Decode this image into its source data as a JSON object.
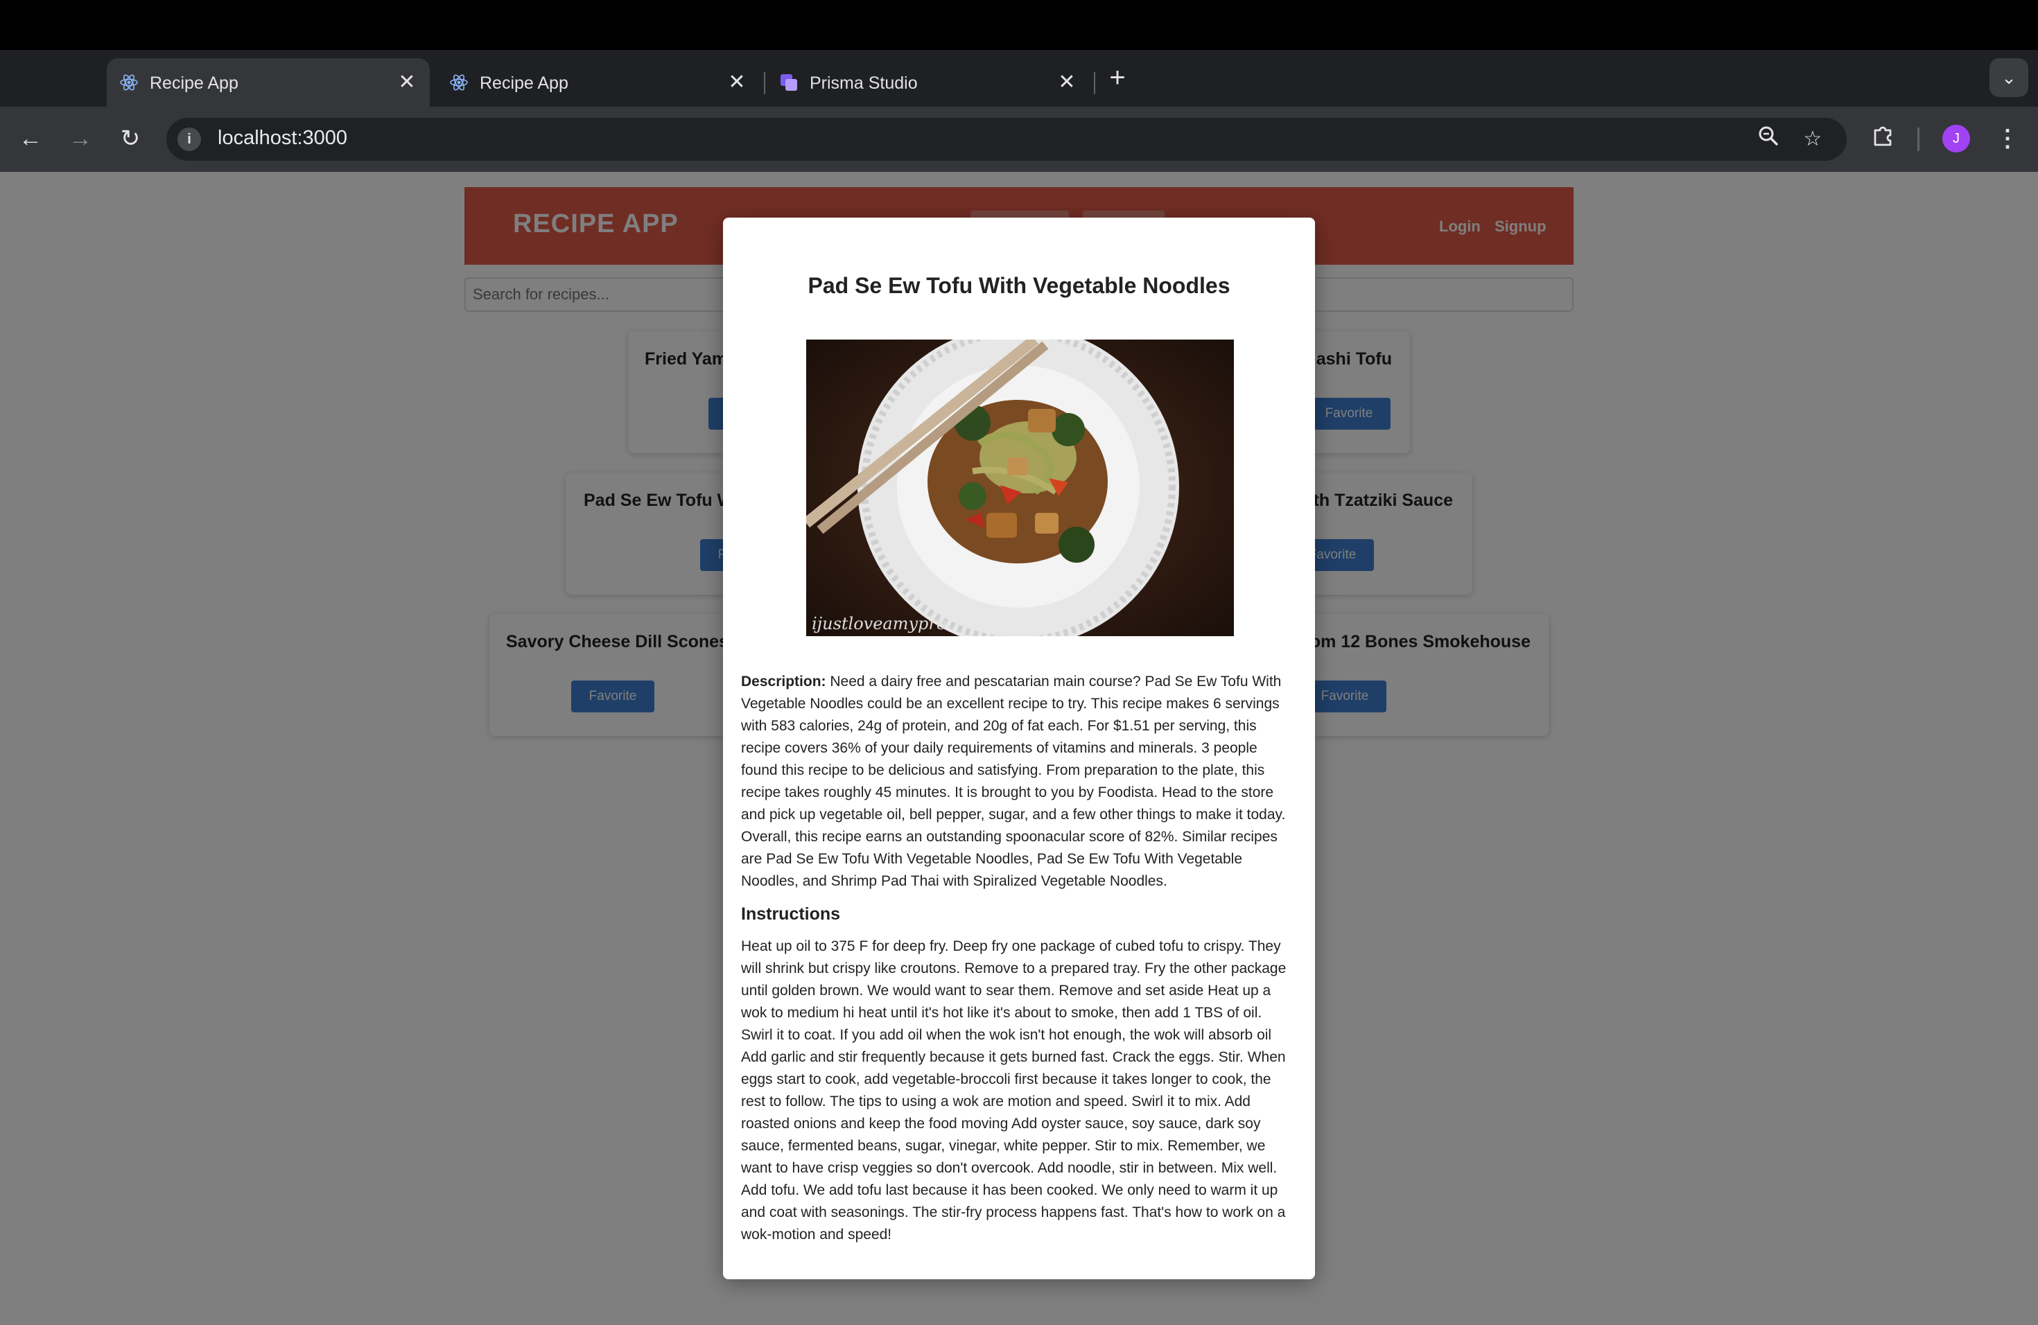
{
  "browser": {
    "tabs": [
      {
        "title": "Recipe App",
        "icon": "react-icon",
        "active": true
      },
      {
        "title": "Recipe App",
        "icon": "react-icon",
        "active": false
      },
      {
        "title": "Prisma Studio",
        "icon": "prisma-icon",
        "active": false
      }
    ],
    "url": "localhost:3000",
    "profile_initial": "J",
    "colors": {
      "profile": "#a142f4",
      "tabstrip": "#1f2023",
      "toolbar": "#35363a"
    }
  },
  "app": {
    "brand": "RECIPE APP",
    "auth": {
      "login": "Login",
      "signup": "Signup"
    },
    "search": {
      "placeholder": "Search for recipes..."
    },
    "colors": {
      "header": "#e05a48",
      "button": "#3f7fd1"
    },
    "cards": [
      {
        "title": "Fried Yam",
        "favorite": "Favorite"
      },
      {
        "title": "ashi Tofu",
        "favorite": "Favorite"
      },
      {
        "title": "Pad Se Ew Tofu W",
        "favorite": "Favorite"
      },
      {
        "title": "ith Tzatziki Sauce",
        "favorite": "Favorite"
      },
      {
        "title": "Savory Cheese Dill Scones",
        "favorite": "Favorite"
      },
      {
        "title": "rom 12 Bones Smokehouse",
        "favorite": "Favorite"
      }
    ]
  },
  "modal": {
    "title": "Pad Se Ew Tofu With Vegetable Noodles",
    "image_watermark": "ijustloveamypro",
    "description_label": "Description:",
    "description": "Need a dairy free and pescatarian main course? Pad Se Ew Tofu With Vegetable Noodles could be an excellent recipe to try. This recipe makes 6 servings with 583 calories, 24g of protein, and 20g of fat each. For $1.51 per serving, this recipe covers 36% of your daily requirements of vitamins and minerals. 3 people found this recipe to be delicious and satisfying. From preparation to the plate, this recipe takes roughly 45 minutes. It is brought to you by Foodista. Head to the store and pick up vegetable oil, bell pepper, sugar, and a few other things to make it today. Overall, this recipe earns an outstanding spoonacular score of 82%. Similar recipes are Pad Se Ew Tofu With Vegetable Noodles, Pad Se Ew Tofu With Vegetable Noodles, and Shrimp Pad Thai with Spiralized Vegetable Noodles.",
    "instructions_heading": "Instructions",
    "instructions": "Heat up oil to 375 F for deep fry. Deep fry one package of cubed tofu to crispy. They will shrink but crispy like croutons. Remove to a prepared tray. Fry the other package until golden brown. We would want to sear them. Remove and set aside Heat up a wok to medium hi heat until it's hot like it's about to smoke, then add 1 TBS of oil. Swirl it to coat. If you add oil when the wok isn't hot enough, the wok will absorb oil Add garlic and stir frequently because it gets burned fast. Crack the eggs. Stir. When eggs start to cook, add vegetable-broccoli first because it takes longer to cook, the rest to follow. The tips to using a wok are motion and speed. Swirl it to mix. Add roasted onions and keep the food moving Add oyster sauce, soy sauce, dark soy sauce, fermented beans, sugar, vinegar, white pepper. Stir to mix. Remember, we want to have crisp veggies so don't overcook. Add noodle, stir in between. Mix well. Add tofu. We add tofu last because it has been cooked. We only need to warm it up and coat with seasonings. The stir-fry process happens fast. That's how to work on a wok-motion and speed!"
  }
}
